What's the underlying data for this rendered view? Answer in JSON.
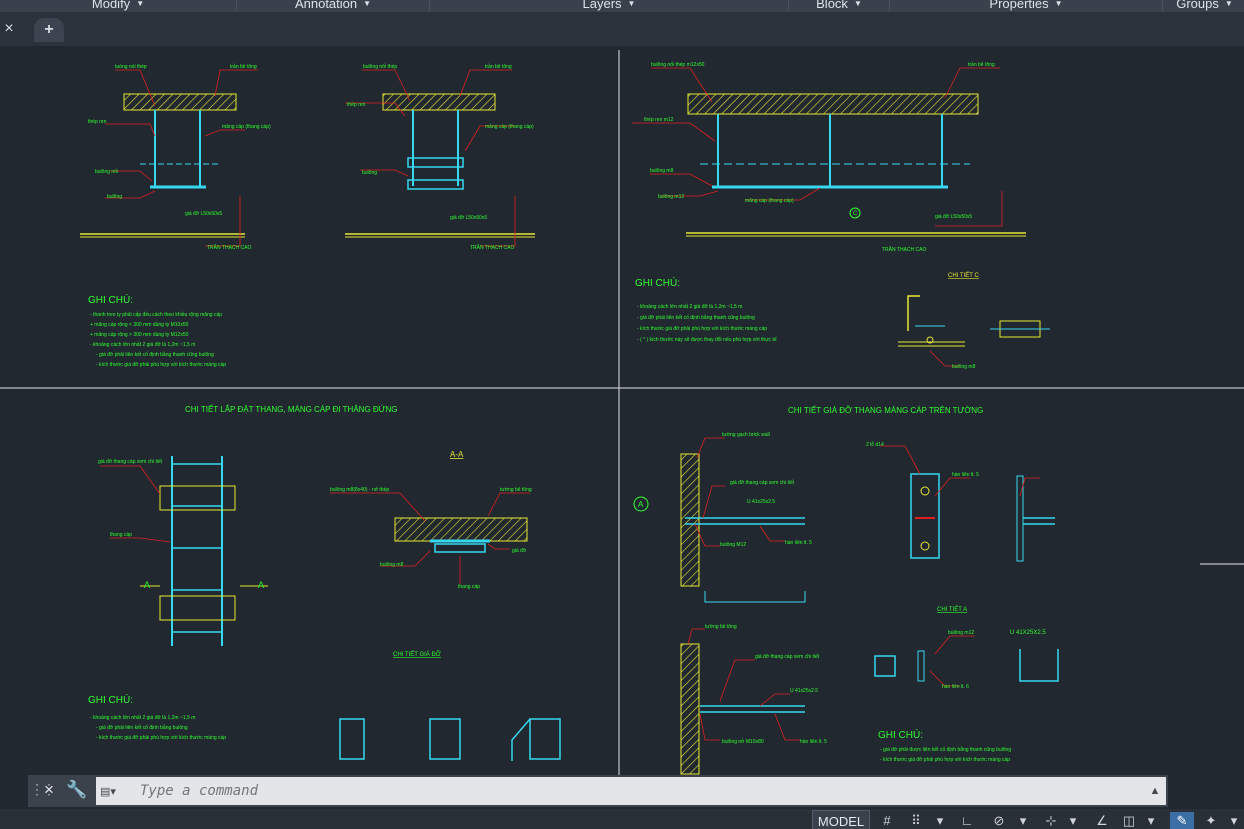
{
  "ribbon": {
    "panels": [
      {
        "label": "Modify"
      },
      {
        "label": "Annotation"
      },
      {
        "label": "Layers"
      },
      {
        "label": "Block"
      },
      {
        "label": "Properties"
      },
      {
        "label": "Groups"
      }
    ]
  },
  "tabs": {
    "close_icon": "×",
    "new_tab_icon": "+"
  },
  "command": {
    "placeholder": "Type a command",
    "close_icon": "×",
    "wrench_icon": "🔧"
  },
  "status": {
    "model_label": "MODEL"
  },
  "colors": {
    "background": "#212830",
    "drawing_yellow": "#e8e832",
    "drawing_cyan": "#36d7f0",
    "drawing_red": "#e02020",
    "drawing_green": "#2fff2f",
    "drawing_white": "#e8e8e8"
  },
  "drawing": {
    "q1": {
      "d1": {
        "labels": [
          "tuòng nói thép",
          "trần bê tông",
          "thép ren",
          "măng cáp (thang cáp)",
          "bulông nối",
          "bulông",
          "giá đỡ L50x50x5",
          "TRẦN THẠCH CAO"
        ]
      },
      "d2": {
        "labels": [
          "bulông nối thép",
          "trần bê tông",
          "thép ren",
          "măng cáp (thang cáp)",
          "bulông",
          "giá đỡ L50x50x5",
          "TRẦN THẠCH CAO"
        ]
      },
      "notes_title": "GHI CHÚ:",
      "notes": [
        "- thanh treo ty phải cấp đều cách theo khiều rộng măng cáp",
        "+ măng cáp rộng < 300 mm dùng ty M10x50",
        "+ măng cáp rộng > 300 mm dùng ty M12x50",
        "- khoảng cách lớn nhất 2 giá đỡ là 1,2m ~1,5 m",
        "- giá đỡ phải liên kết cố định bằng thanh cũng bulông",
        "- kích thước giá đỡ phải phù hợp với kích thước máng cáp"
      ]
    },
    "q2": {
      "labels": [
        "bulông nối thép m12x50",
        "trần bê tông",
        "thép ren m12",
        "bulông m8",
        "bulông m12",
        "măng cáp (thang cáp)",
        "giá đỡ L50x50x5",
        "TRẦN THẠCH CAO"
      ],
      "marker": "C",
      "notes_title": "GHI CHÚ:",
      "notes": [
        "- khoảng cách lớn nhất 2 giá đỡ là 1,2m ~1,5 m",
        "- giá đỡ phải liên kết cố định bằng thanh cũng bulông",
        "- kích thước giá đỡ phải phù hợp với kích thước máng cáp",
        "- ( * ) kích thước này sẽ được thay đổi nếu phù hợp với thực tế"
      ],
      "detail_title": "CHI TIẾT C",
      "detail_label": "bulông m8"
    },
    "q3": {
      "title": "CHI TIẾT LẮP ĐẶT THANG, MÁNG CÁP ĐI THẲNG ĐỨNG",
      "labels": [
        "giá đỡ thang cáp xem chi tiết",
        "thang cáp",
        "A",
        "A"
      ],
      "section_title": "A-A",
      "section_labels": [
        "bulông m8(8x40) - nở thép",
        "tường bê tông",
        "giá đỡ",
        "bulông m8",
        "thang cáp"
      ],
      "support_title": "CHI TIẾT GIÁ ĐỠ",
      "notes_title": "GHI CHÚ:",
      "notes": [
        "- khoảng cách lớn nhất 2 giá đỡ là 1,2m ~1,5 m",
        "- giá đỡ phải liên kết cố định bằng bulông",
        "- kích thước giá đỡ phải phù hợp với kích thước máng cáp"
      ]
    },
    "q4": {
      "title": "CHI TIẾT GIÁ ĐỠ THANG MÁNG CÁP TRÊN TƯỜNG",
      "labels": [
        "tường gạch brick wall",
        "giá đỡ thang cáp xem chi tiết",
        "U 41x25x2.5",
        "bulông M12",
        "hàn liên lt. 5",
        "2 lỗ d14",
        "hàn liên lt. 5"
      ],
      "marker": "A",
      "detail_title": "CHI TIẾT A",
      "detail_labels": [
        "bulông m12",
        "hàn liên lt. 6",
        "U 41X25X2.5"
      ],
      "wall_labels": [
        "tường bê tông",
        "giá đỡ thang cáp xem chi tiết",
        "U 41x25x2.5",
        "bulông nở M10x80",
        "hàn liên lt. 5"
      ],
      "notes_title": "GHI CHÚ:",
      "notes": [
        "- giá đỡ phải được liên kết cố định bằng thanh cũng bulông",
        "- kích thước giá đỡ phải phù hợp với kích thước máng cáp"
      ]
    }
  }
}
